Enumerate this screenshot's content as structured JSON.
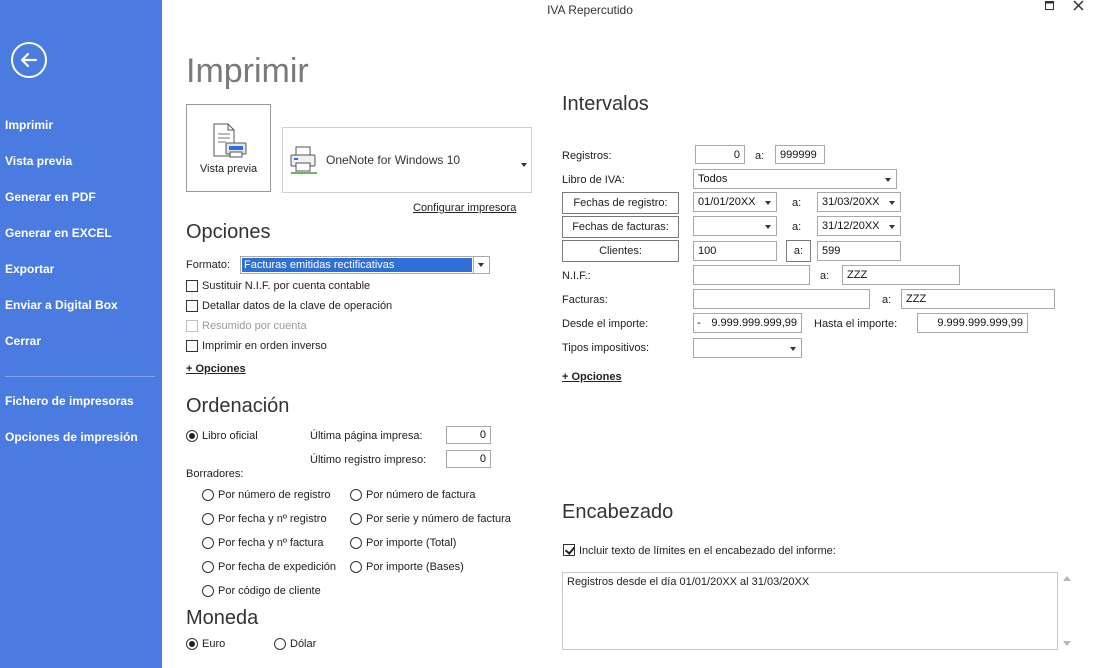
{
  "window": {
    "title": "IVA Repercutido"
  },
  "sidebar": {
    "items": [
      {
        "label": "Imprimir"
      },
      {
        "label": "Vista previa"
      },
      {
        "label": "Generar en PDF"
      },
      {
        "label": "Generar en EXCEL"
      },
      {
        "label": "Exportar"
      },
      {
        "label": "Enviar a Digital Box"
      },
      {
        "label": "Cerrar"
      },
      {
        "label": "Fichero de impresoras"
      },
      {
        "label": "Opciones de impresión"
      }
    ]
  },
  "print": {
    "heading": "Imprimir",
    "preview_label": "Vista previa",
    "printer_name": "OneNote for Windows 10",
    "configure_link": "Configurar impresora"
  },
  "opciones": {
    "heading": "Opciones",
    "formato_label": "Formato:",
    "formato_value": "Facturas emitidas rectificativas",
    "checks": [
      {
        "label": "Sustituir N.I.F. por cuenta contable",
        "checked": false,
        "enabled": true
      },
      {
        "label": "Detallar datos de la clave de operación",
        "checked": false,
        "enabled": true
      },
      {
        "label": "Resumido por cuenta",
        "checked": false,
        "enabled": false
      },
      {
        "label": "Imprimir en orden inverso",
        "checked": false,
        "enabled": true
      }
    ],
    "more_link": "+ Opciones"
  },
  "ordenacion": {
    "heading": "Ordenación",
    "libro_oficial": "Libro oficial",
    "ultima_pagina_label": "Última página impresa:",
    "ultima_pagina_value": "0",
    "ultimo_registro_label": "Último registro impreso:",
    "ultimo_registro_value": "0",
    "borradores_label": "Borradores:",
    "options": [
      "Por número de registro",
      "Por número de factura",
      "Por fecha y nº registro",
      "Por serie y número de factura",
      "Por fecha y nº factura",
      "Por importe (Total)",
      "Por fecha de expedición",
      "Por importe (Bases)",
      "Por código de cliente"
    ]
  },
  "moneda": {
    "heading": "Moneda",
    "euro": "Euro",
    "dolar": "Dólar"
  },
  "intervalos": {
    "heading": "Intervalos",
    "registros_label": "Registros:",
    "registros_from": "0",
    "a": "a:",
    "registros_to": "999999",
    "libro_label": "Libro de IVA:",
    "libro_value": "Todos",
    "fechas_registro_label": "Fechas de registro:",
    "fechas_registro_from": "01/01/20XX",
    "fechas_registro_to": "31/03/20XX",
    "fechas_facturas_label": "Fechas de facturas:",
    "fechas_facturas_from": "",
    "fechas_facturas_to": "31/12/20XX",
    "clientes_label": "Clientes:",
    "clientes_from": "100",
    "clientes_to": "599",
    "nif_label": "N.I.F.:",
    "nif_from": "",
    "nif_to": "ZZZ",
    "facturas_label": "Facturas:",
    "facturas_from": "",
    "facturas_to": "ZZZ",
    "desde_importe_label": "Desde el importe:",
    "desde_importe_sign": "-",
    "desde_importe_value": "9.999.999.999,99",
    "hasta_importe_label": "Hasta el importe:",
    "hasta_importe_value": "9.999.999.999,99",
    "tipos_label": "Tipos impositivos:",
    "tipos_value": "",
    "more_link": "+ Opciones"
  },
  "encabezado": {
    "heading": "Encabezado",
    "include_label": "Incluir texto de límites en el encabezado del informe:",
    "include_checked": true,
    "text": "Registros desde el día 01/01/20XX al 31/03/20XX"
  },
  "colors": {
    "sidebar": "#4a7be1",
    "selection": "#2f6fd8"
  }
}
